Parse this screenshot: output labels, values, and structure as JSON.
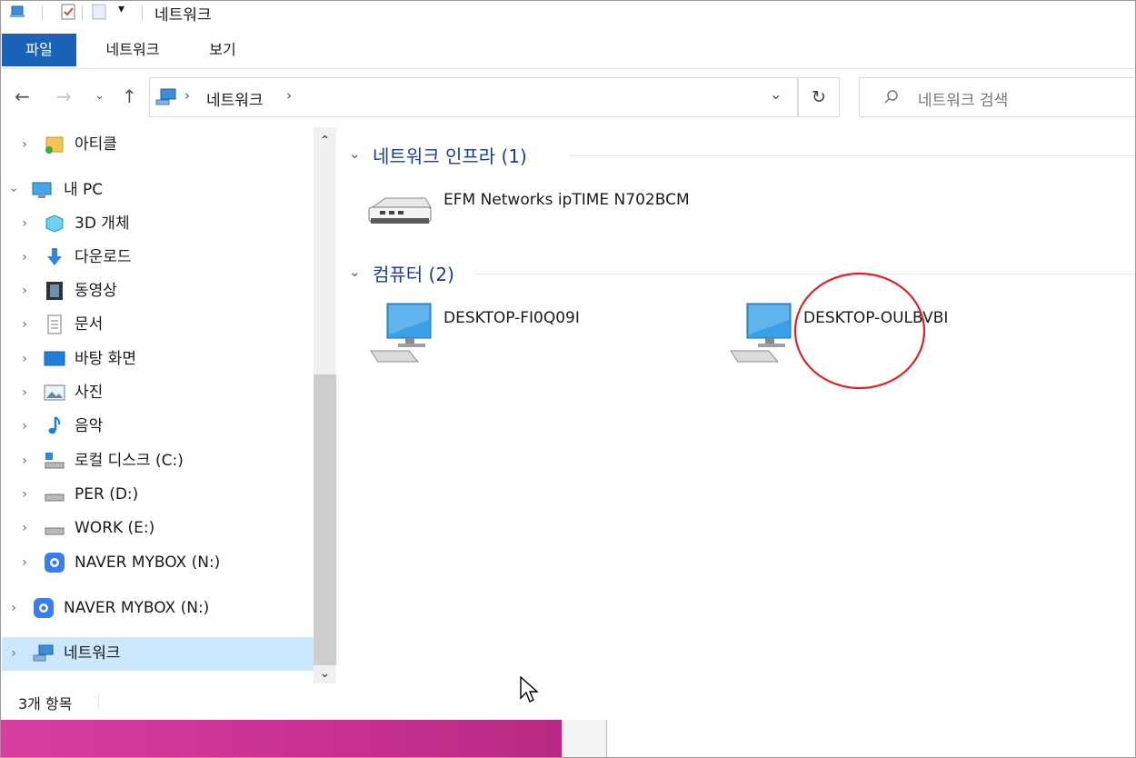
{
  "window": {
    "title": "네트워크"
  },
  "ribbon": {
    "tabs": [
      {
        "label": "파일"
      },
      {
        "label": "네트워크"
      },
      {
        "label": "보기"
      }
    ]
  },
  "address": {
    "segment": "네트워크",
    "search_placeholder": "네트워크 검색"
  },
  "sidebar": {
    "items": [
      {
        "label": "아티클"
      },
      {
        "label": "내 PC"
      },
      {
        "label": "3D 개체"
      },
      {
        "label": "다운로드"
      },
      {
        "label": "동영상"
      },
      {
        "label": "문서"
      },
      {
        "label": "바탕 화면"
      },
      {
        "label": "사진"
      },
      {
        "label": "음악"
      },
      {
        "label": "로컬 디스크 (C:)"
      },
      {
        "label": "PER (D:)"
      },
      {
        "label": "WORK (E:)"
      },
      {
        "label": "NAVER MYBOX (N:)"
      },
      {
        "label": "NAVER MYBOX (N:)"
      },
      {
        "label": "네트워크"
      }
    ]
  },
  "main": {
    "groups": [
      {
        "header": "네트워크 인프라 (1)",
        "items": [
          {
            "label": "EFM Networks ipTIME N702BCM",
            "icon": "router-icon"
          }
        ]
      },
      {
        "header": "컴퓨터 (2)",
        "items": [
          {
            "label": "DESKTOP-FI0Q09I",
            "icon": "computer-icon"
          },
          {
            "label": "DESKTOP-OULBVBI",
            "icon": "computer-icon"
          }
        ]
      }
    ],
    "annotation_color": "#d9252b"
  },
  "status": {
    "item_count": "3개 항목"
  },
  "colors": {
    "file_tab": "#1a63b8",
    "selection": "#cce8ff",
    "group_header": "#1e3c8f",
    "taskbar": "#d93ea3"
  }
}
